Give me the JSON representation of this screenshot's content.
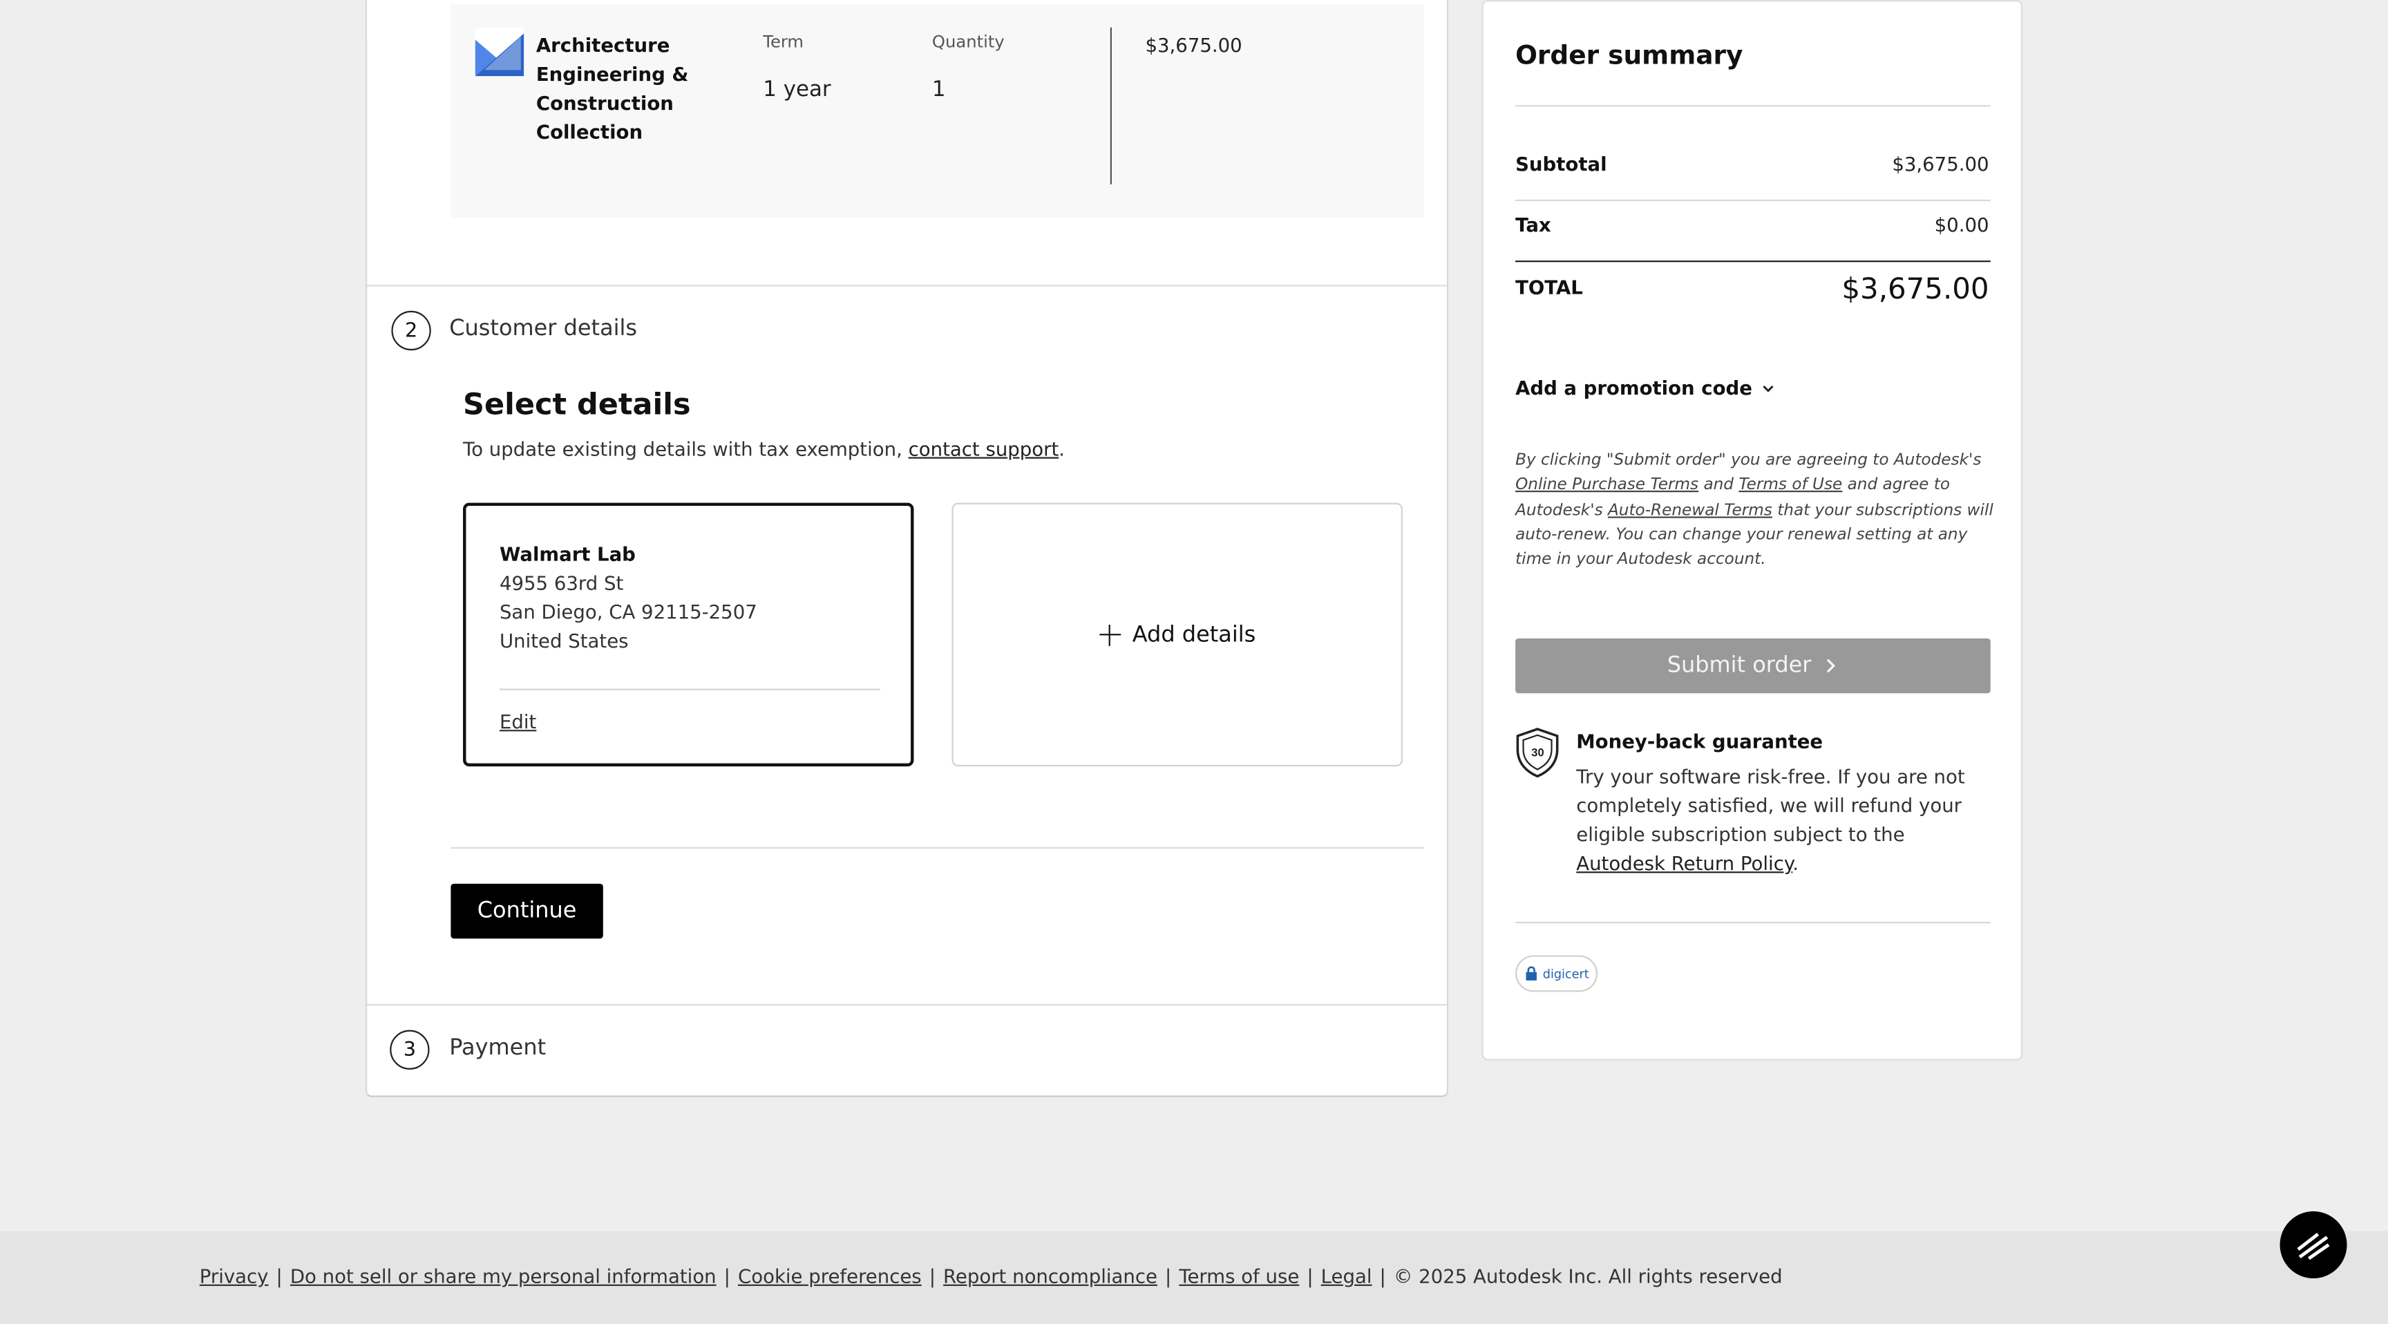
{
  "product": {
    "name": "Architecture Engineering & Construction Collection",
    "term_label": "Term",
    "term_value": "1 year",
    "quantity_label": "Quantity",
    "quantity_value": "1",
    "price": "$3,675.00"
  },
  "steps": {
    "customer_number": "2",
    "customer_label": "Customer details",
    "payment_number": "3",
    "payment_label": "Payment"
  },
  "select_details": {
    "title": "Select details",
    "update_prefix": "To update existing details with tax exemption, ",
    "contact_link": "contact support",
    "update_suffix": "."
  },
  "address_card": {
    "name": "Walmart Lab",
    "street": "4955 63rd St",
    "city": "San Diego, CA 92115-2507",
    "country": "United States",
    "edit_label": "Edit"
  },
  "add_details_label": "Add details",
  "continue_label": "Continue",
  "summary": {
    "title": "Order summary",
    "subtotal_label": "Subtotal",
    "subtotal_value": "$3,675.00",
    "tax_label": "Tax",
    "tax_value": "$0.00",
    "total_label": "TOTAL",
    "total_value": "$3,675.00",
    "promo_label": "Add a promotion code",
    "legal_1": "By clicking \"Submit order\" you are agreeing to Autodesk's ",
    "legal_link_1": "Online Purchase Terms",
    "legal_2": " and ",
    "legal_link_2": "Terms of Use",
    "legal_3": " and agree to Autodesk's ",
    "legal_link_3": "Auto-Renewal Terms",
    "legal_4": " that your subscriptions will auto-renew. You can change your renewal setting at any time in your Autodesk account.",
    "submit_label": "Submit order",
    "guarantee_title": "Money-back guarantee",
    "guarantee_text": "Try your software risk-free. If you are not completely satisfied, we will refund your eligible subscription subject to the ",
    "guarantee_link": "Autodesk Return Policy",
    "guarantee_suffix": ".",
    "shield_badge": "30",
    "digicert_label": "digicert"
  },
  "footer": {
    "links": [
      "Privacy",
      "Do not sell or share my personal information",
      "Cookie preferences",
      "Report noncompliance",
      "Terms of use",
      "Legal"
    ],
    "separator": "|",
    "copyright": "© 2025 Autodesk Inc. All rights reserved"
  },
  "icons": {
    "product_logo": "aec-collection-logo-icon",
    "chevron": "chevron-down-icon",
    "submit_arrow": "chevron-right-icon",
    "shield": "shield-30-icon",
    "chat": "chat-icon"
  }
}
